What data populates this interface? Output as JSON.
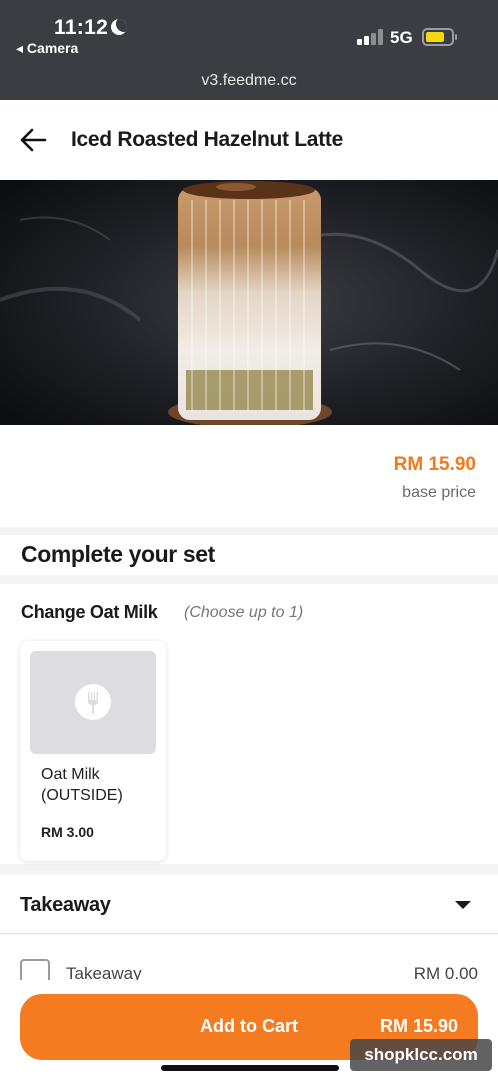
{
  "status_bar": {
    "time": "11:12",
    "back_app_label": "◂ Camera",
    "network": "5G",
    "url": "v3.feedme.cc"
  },
  "header": {
    "back_icon": "back-arrow-icon",
    "title": "Iced Roasted Hazelnut Latte"
  },
  "product": {
    "price": "RM 15.90",
    "price_label": "base price"
  },
  "complete_set": {
    "title": "Complete your set"
  },
  "option_group": {
    "title": "Change Oat Milk",
    "hint": "(Choose up to 1)",
    "items": [
      {
        "name": "Oat Milk (OUTSIDE)",
        "price": "RM 3.00",
        "icon": "fork-icon"
      }
    ]
  },
  "takeaway": {
    "title": "Takeaway",
    "rows": [
      {
        "label": "Takeaway",
        "price": "RM 0.00",
        "checked": false
      }
    ]
  },
  "cart": {
    "button_label": "Add to Cart",
    "total": "RM 15.90"
  },
  "watermark": "shopklcc.com",
  "colors": {
    "accent": "#f47b20",
    "price": "#f07a1e",
    "status_bar": "#3a3d41"
  }
}
